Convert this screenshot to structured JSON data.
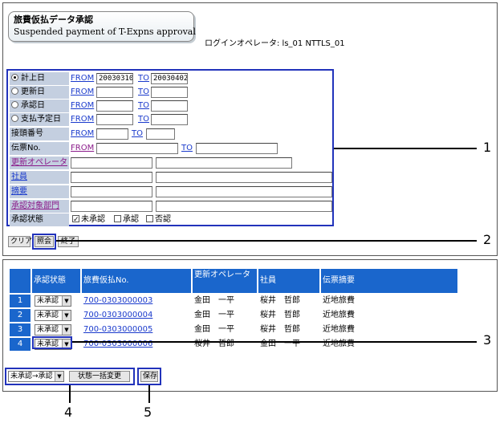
{
  "header": {
    "title_ja": "旅費仮払データ承認",
    "title_en": "Suspended payment of T-Expns approval",
    "login_info": "ログインオペレータ: ls_01  NTTLS_01"
  },
  "search": {
    "date_rows": [
      {
        "label": "計上日",
        "from_label": "FROM",
        "from_value": "20030310",
        "to_label": "TO",
        "to_value": "20030402",
        "selected": true
      },
      {
        "label": "更新日",
        "from_label": "FROM",
        "from_value": "",
        "to_label": "TO",
        "to_value": "",
        "selected": false
      },
      {
        "label": "承認日",
        "from_label": "FROM",
        "from_value": "",
        "to_label": "TO",
        "to_value": "",
        "selected": false
      },
      {
        "label": "支払予定日",
        "from_label": "FROM",
        "from_value": "",
        "to_label": "TO",
        "to_value": "",
        "selected": false
      }
    ],
    "connect_no": {
      "label": "接頭番号",
      "from_label": "FROM",
      "to_label": "TO"
    },
    "slip_no": {
      "label": "伝票No.",
      "from_label": "FROM",
      "to_label": "TO"
    },
    "update_operator": {
      "label": "更新オペレータ"
    },
    "employee": {
      "label": "社員"
    },
    "summary": {
      "label": "摘要"
    },
    "approval_dept": {
      "label": "承認対象部門"
    },
    "approval_status": {
      "label": "承認状態",
      "options": [
        {
          "label": "未承認",
          "checked": true
        },
        {
          "label": "承認",
          "checked": false
        },
        {
          "label": "否認",
          "checked": false
        }
      ]
    }
  },
  "buttons": {
    "clear": "クリア",
    "inquiry": "照会",
    "end": "終了",
    "bulk_change": "状態一括変更",
    "save": "保存",
    "bulk_select": "未承認→承認"
  },
  "table": {
    "headers": [
      "承認状態",
      "旅費仮払No.",
      "更新オペレータ",
      "社員",
      "伝票摘要"
    ],
    "rows": [
      {
        "index": "1",
        "status": "未承認",
        "no": "700-0303000003",
        "operator": "金田　一平",
        "employee": "桜井　哲郎",
        "summary": "近地旅費"
      },
      {
        "index": "2",
        "status": "未承認",
        "no": "700-0303000004",
        "operator": "金田　一平",
        "employee": "桜井　哲郎",
        "summary": "近地旅費"
      },
      {
        "index": "3",
        "status": "未承認",
        "no": "700-0303000005",
        "operator": "金田　一平",
        "employee": "桜井　哲郎",
        "summary": "近地旅費"
      },
      {
        "index": "4",
        "status": "未承認",
        "no": "700-0303000006",
        "operator": "桜井　哲郎",
        "employee": "金田　一平",
        "summary": "近地旅費"
      }
    ]
  },
  "callouts": [
    "1",
    "2",
    "3",
    "4",
    "5"
  ]
}
